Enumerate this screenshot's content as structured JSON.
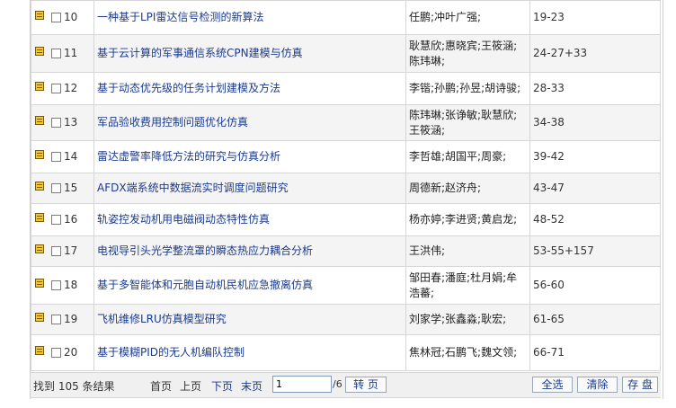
{
  "rows": [
    {
      "num": "10",
      "title": "一种基于LPI雷达信号检测的新算法",
      "authors": "任鹏;冲叶广强;",
      "pages": "19-23"
    },
    {
      "num": "11",
      "title": "基于云计算的军事通信系统CPN建模与仿真",
      "authors": "耿慧欣;惠晓宾;王筱涵;陈玮琳;",
      "pages": "24-27+33"
    },
    {
      "num": "12",
      "title": "基于动态优先级的任务计划建模及方法",
      "authors": "李锴;孙鹏;孙昱;胡诗骏;",
      "pages": "28-33"
    },
    {
      "num": "13",
      "title": "军品验收费用控制问题优化仿真",
      "authors": "陈玮琳;张诤敏;耿慧欣;王筱涵;",
      "pages": "34-38"
    },
    {
      "num": "14",
      "title": "雷达虚警率降低方法的研究与仿真分析",
      "authors": "李哲雄;胡国平;周豪;",
      "pages": "39-42"
    },
    {
      "num": "15",
      "title": "AFDX端系统中数据流实时调度问题研究",
      "authors": "周德新;赵济舟;",
      "pages": "43-47"
    },
    {
      "num": "16",
      "title": "轨姿控发动机用电磁阀动态特性仿真",
      "authors": "杨亦婷;李进贤;黄启龙;",
      "pages": "48-52"
    },
    {
      "num": "17",
      "title": "电视导引头光学整流罩的瞬态热应力耦合分析",
      "authors": "王洪伟;",
      "pages": "53-55+157"
    },
    {
      "num": "18",
      "title": "基于多智能体和元胞自动机民机应急撤离仿真",
      "authors": "邹田春;潘庭;杜月娟;牟浩蕃;",
      "pages": "56-60"
    },
    {
      "num": "19",
      "title": "飞机维修LRU仿真模型研究",
      "authors": "刘家学;张鑫淼;耿宏;",
      "pages": "61-65"
    },
    {
      "num": "20",
      "title": "基于模糊PID的无人机编队控制",
      "authors": "焦林冠;石鹏飞;魏文领;",
      "pages": "66-71"
    }
  ],
  "footer": {
    "result_count": "找到 105 条结果",
    "first": "首页",
    "prev": "上页",
    "next": "下页",
    "last": "末页",
    "page_value": "1",
    "total_pages": "/6",
    "go": "转 页",
    "select_all": "全选",
    "clear": "清除",
    "save": "存 盘"
  }
}
